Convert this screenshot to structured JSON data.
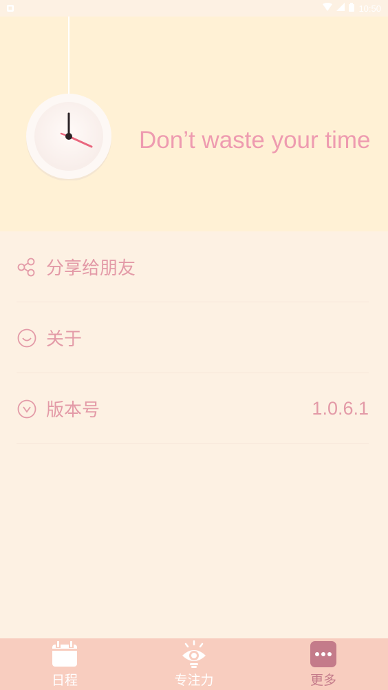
{
  "status_bar": {
    "time": "10:50"
  },
  "header": {
    "motto": "Don’t waste your time",
    "clock_icon": "clock-icon"
  },
  "menu": {
    "items": [
      {
        "label": "分享给朋友",
        "icon": "share-icon",
        "value": ""
      },
      {
        "label": "关于",
        "icon": "smile-icon",
        "value": ""
      },
      {
        "label": "版本号",
        "icon": "chevron-circle-icon",
        "value": "1.0.6.1"
      }
    ]
  },
  "bottom_nav": {
    "tabs": [
      {
        "label": "日程",
        "icon": "calendar-icon",
        "active": false
      },
      {
        "label": "专注力",
        "icon": "eye-icon",
        "active": false
      },
      {
        "label": "更多",
        "icon": "more-icon",
        "active": true
      }
    ]
  },
  "colors": {
    "header_bg": "#fff1d5",
    "page_bg": "#fdf1e3",
    "accent_pink": "#e39aa7",
    "nav_bg": "#f8cdbf",
    "nav_active": "#c47b8a"
  }
}
